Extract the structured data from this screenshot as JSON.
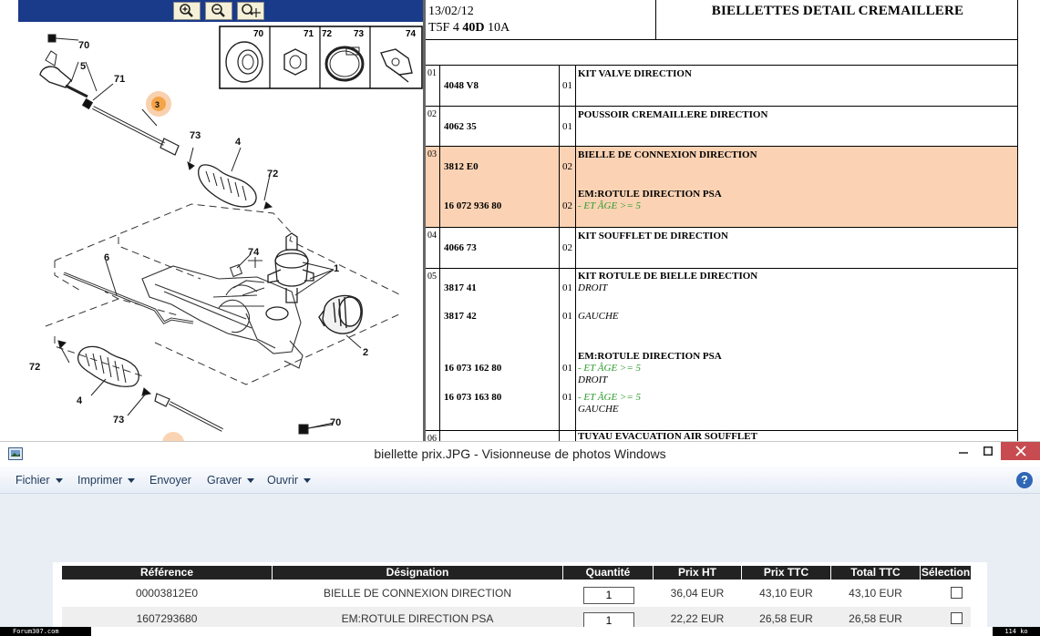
{
  "catalog": {
    "date": "13/02/12",
    "vehicle_code": "T5F 4",
    "vehicle_bold": "40D",
    "vehicle_suffix": "10A",
    "title": "BIELLETTES DETAIL CREMAILLERE",
    "diagram_labels": {
      "l70a": "70",
      "l5": "5",
      "l71": "71",
      "l3": "3",
      "l73a": "73",
      "l4a": "4",
      "l72a": "72",
      "l74": "74",
      "l6": "6",
      "l1": "1",
      "l2": "2",
      "l72b": "72",
      "l4b": "4",
      "l73b": "73",
      "l70b": "70"
    },
    "legend_numbers": [
      "70",
      "71",
      "72",
      "73",
      "74"
    ],
    "rows": [
      {
        "num": "01",
        "lines": [
          {
            "ref": "4048 V8",
            "qty": "01",
            "desc": "KIT VALVE DIRECTION"
          }
        ]
      },
      {
        "num": "02",
        "lines": [
          {
            "ref": "4062 35",
            "qty": "01",
            "desc": "POUSSOIR CREMAILLERE DIRECTION"
          }
        ]
      },
      {
        "num": "03",
        "lines": [
          {
            "ref": "3812 E0",
            "qty": "02",
            "desc": "BIELLE DE CONNEXION DIRECTION"
          },
          {
            "ref": "16 072 936 80",
            "qty": "02",
            "desc": "EM:ROTULE DIRECTION PSA",
            "note": "- ET ÂGE >= 5"
          }
        ]
      },
      {
        "num": "04",
        "lines": [
          {
            "ref": "4066 73",
            "qty": "02",
            "desc": "KIT SOUFFLET DE DIRECTION"
          }
        ]
      },
      {
        "num": "05",
        "lines": [
          {
            "ref": "3817 41",
            "qty": "01",
            "desc": "KIT ROTULE DE BIELLE DIRECTION",
            "sub": "DROIT"
          },
          {
            "ref": "3817 42",
            "qty": "01",
            "sub": "GAUCHE"
          },
          {
            "ref": "16 073 162 80",
            "qty": "01",
            "desc": "EM:ROTULE DIRECTION PSA",
            "note": "- ET ÂGE >= 5",
            "sub": "DROIT"
          },
          {
            "ref": "16 073 163 80",
            "qty": "01",
            "note": "- ET ÂGE >= 5",
            "sub": "GAUCHE"
          }
        ]
      },
      {
        "num": "06",
        "lines": [
          {
            "desc": "TUYAU EVACUATION AIR SOUFFLET"
          }
        ]
      }
    ]
  },
  "window": {
    "title": "biellette prix.JPG - Visionneuse de photos Windows",
    "menu": [
      "Fichier",
      "Imprimer",
      "Envoyer",
      "Graver",
      "Ouvrir"
    ],
    "help_label": "?"
  },
  "order": {
    "headers": [
      "Référence",
      "Désignation",
      "Quantité",
      "Prix HT",
      "Prix TTC",
      "Total TTC",
      "Sélection"
    ],
    "rows": [
      {
        "ref": "00003812E0",
        "designation": "BIELLE DE CONNEXION DIRECTION",
        "qty": "1",
        "ht": "36,04 EUR",
        "ttc": "43,10 EUR",
        "total": "43,10 EUR"
      },
      {
        "ref": "1607293680",
        "designation": "EM:ROTULE DIRECTION PSA",
        "qty": "1",
        "ht": "22,22 EUR",
        "ttc": "26,58 EUR",
        "total": "26,58 EUR"
      }
    ]
  },
  "footer": {
    "forum": "Forum307.com",
    "size": "114 ko"
  },
  "colors": {
    "highlight_row": "#fbd3b4",
    "close_button": "#c74b50",
    "green_note": "#2a9a2a"
  }
}
